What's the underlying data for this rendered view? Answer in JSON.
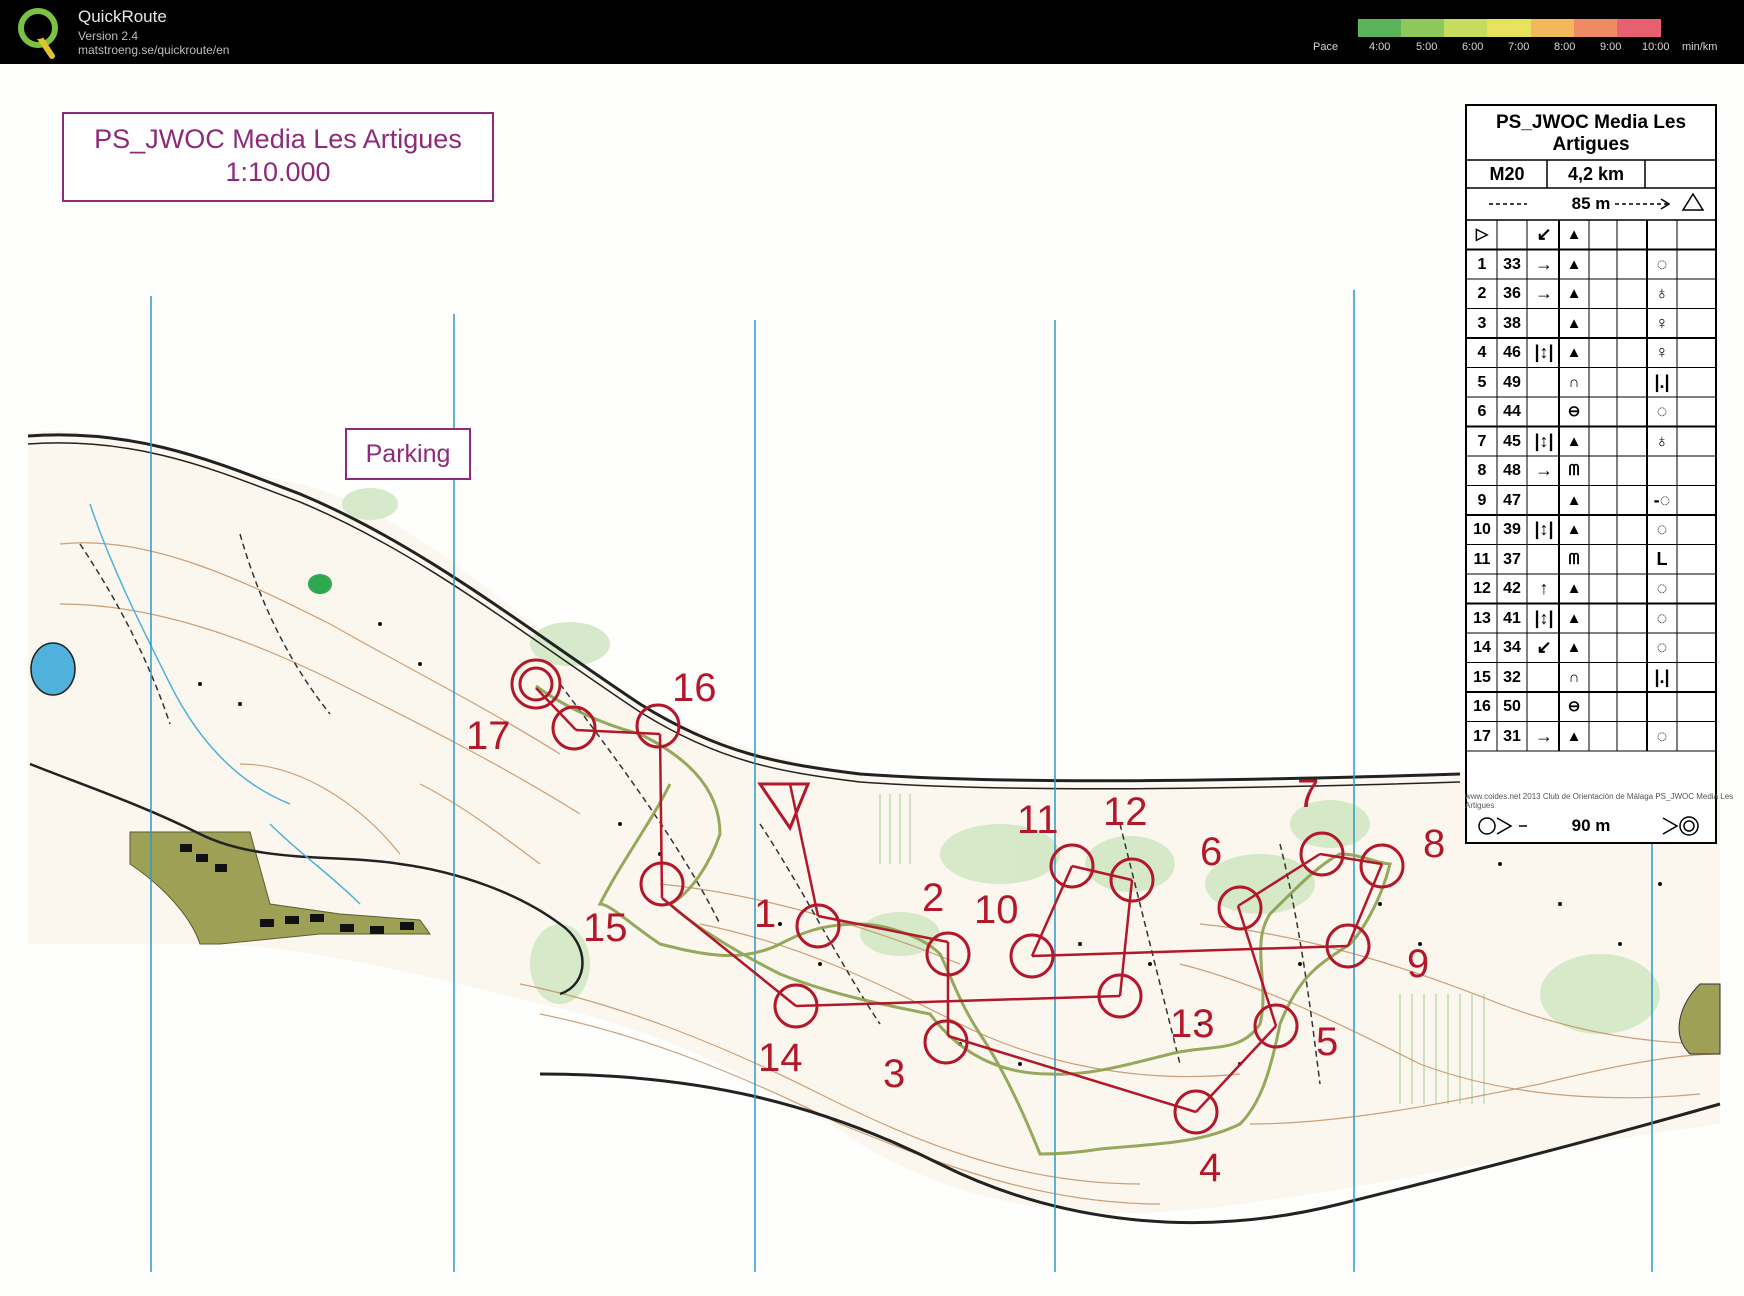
{
  "app": {
    "name": "QuickRoute",
    "version": "Version 2.4",
    "url": "matstroeng.se/quickroute/en",
    "logo_icon": "quickroute-q-logo-icon"
  },
  "pace_legend": {
    "label": "Pace",
    "ticks": [
      "4:00",
      "5:00",
      "6:00",
      "7:00",
      "8:00",
      "9:00",
      "10:00"
    ],
    "unit": "min/km",
    "colors": [
      "#5bb35a",
      "#8ec85a",
      "#c5dc5e",
      "#e8e25c",
      "#f2b95a",
      "#ee8a64",
      "#e8606f"
    ]
  },
  "map": {
    "title": "PS_JWOC Media Les Artigues",
    "scale": "1:10.000",
    "parking_label": "Parking",
    "credit": "www.coides.net 2013 Club de Orientación de Málaga PS_JWOC Media Les Artigues",
    "control_circle_color": "#b3182a",
    "route_color": "#8aa04a",
    "grid_line_color": "#2a9bc7",
    "control_numbers": [
      "1",
      "2",
      "3",
      "4",
      "5",
      "6",
      "7",
      "8",
      "9",
      "10",
      "11",
      "12",
      "13",
      "14",
      "15",
      "16",
      "17"
    ]
  },
  "control_description": {
    "title": "PS_JWOC Media Les Artigues",
    "class": "M20",
    "length": "4,2 km",
    "climb": "85 m",
    "start_symbol": "▷",
    "start_dir": "↙",
    "start_feature": "▲",
    "finish_distance": "90 m",
    "rows": [
      {
        "num": "1",
        "code": "33",
        "dir": "→",
        "feat": "▲",
        "pos": "◌"
      },
      {
        "num": "2",
        "code": "36",
        "dir": "→",
        "feat": "▲",
        "pos": "♁"
      },
      {
        "num": "3",
        "code": "38",
        "dir": "",
        "feat": "▲",
        "pos": "♀"
      },
      {
        "num": "4",
        "code": "46",
        "dir": "|↕|",
        "feat": "▲",
        "pos": "♀"
      },
      {
        "num": "5",
        "code": "49",
        "dir": "",
        "feat": "∩",
        "pos": "|.|"
      },
      {
        "num": "6",
        "code": "44",
        "dir": "",
        "feat": "⊖",
        "pos": "◌"
      },
      {
        "num": "7",
        "code": "45",
        "dir": "|↕|",
        "feat": "▲",
        "pos": "♁"
      },
      {
        "num": "8",
        "code": "48",
        "dir": "→",
        "feat": "ᗰ",
        "pos": ""
      },
      {
        "num": "9",
        "code": "47",
        "dir": "",
        "feat": "▲",
        "pos": "-◌"
      },
      {
        "num": "10",
        "code": "39",
        "dir": "|↕|",
        "feat": "▲",
        "pos": "◌"
      },
      {
        "num": "11",
        "code": "37",
        "dir": "",
        "feat": "ᗰ",
        "pos": "L"
      },
      {
        "num": "12",
        "code": "42",
        "dir": "↑",
        "feat": "▲",
        "pos": "◌"
      },
      {
        "num": "13",
        "code": "41",
        "dir": "|↕|",
        "feat": "▲",
        "pos": "◌"
      },
      {
        "num": "14",
        "code": "34",
        "dir": "↙",
        "feat": "▲",
        "pos": "◌"
      },
      {
        "num": "15",
        "code": "32",
        "dir": "",
        "feat": "∩",
        "pos": "|.|"
      },
      {
        "num": "16",
        "code": "50",
        "dir": "",
        "feat": "⊖",
        "pos": ""
      },
      {
        "num": "17",
        "code": "31",
        "dir": "→",
        "feat": "▲",
        "pos": "◌"
      }
    ]
  }
}
